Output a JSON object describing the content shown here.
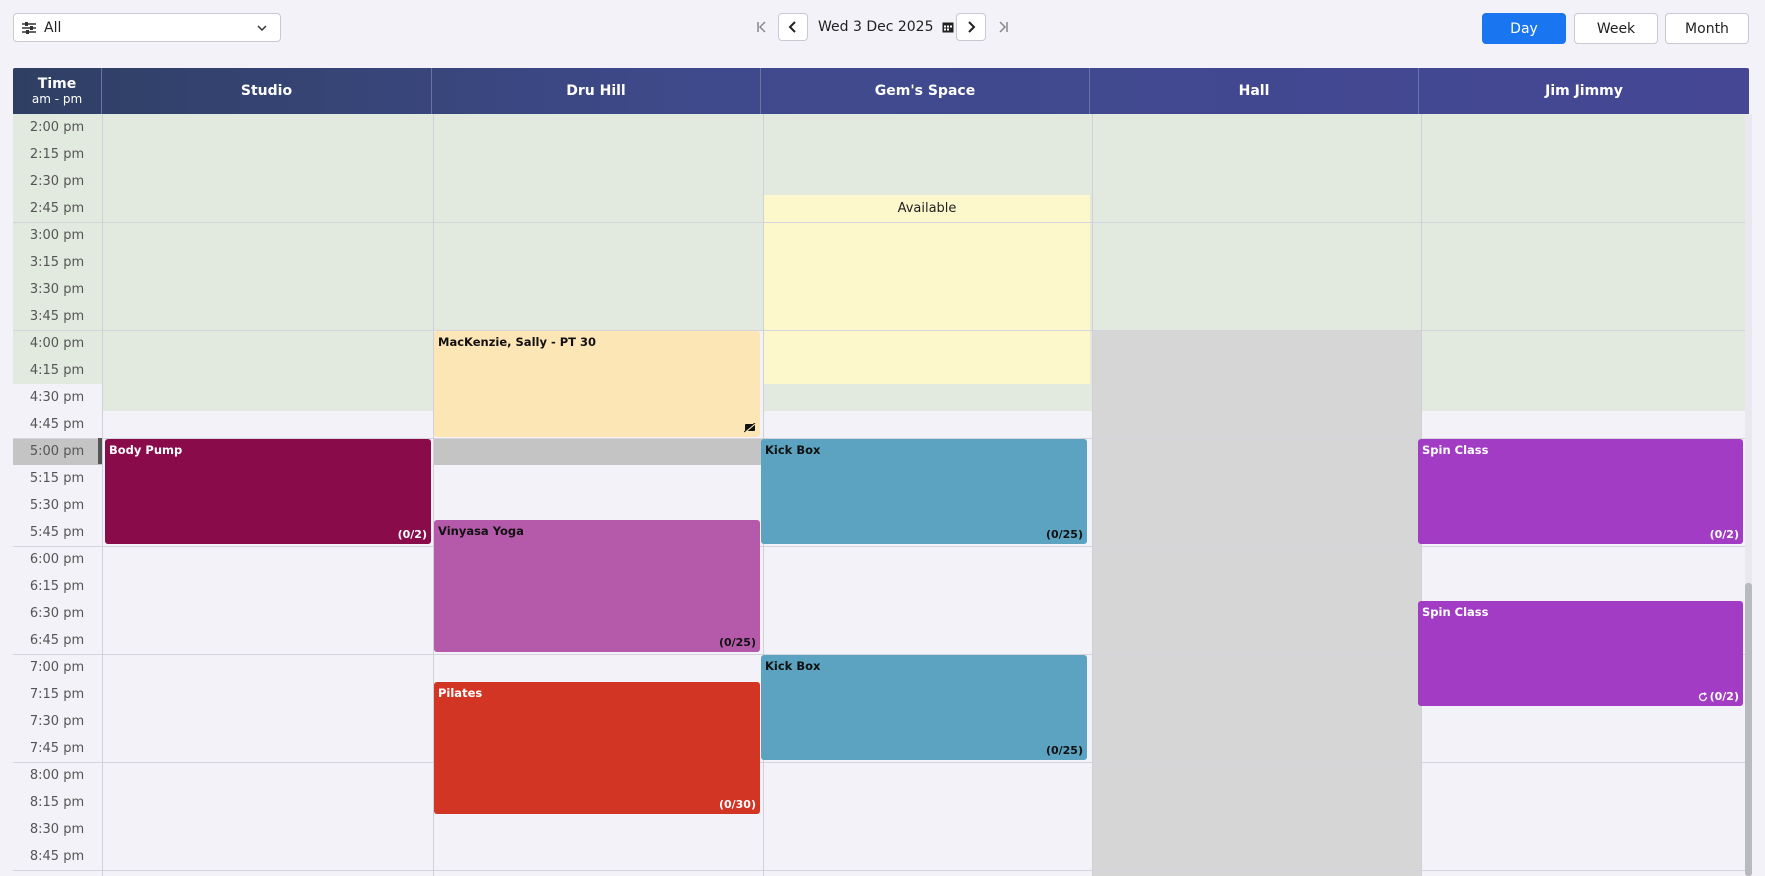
{
  "toolbar": {
    "filter_value": "All",
    "date_label": "Wed 3 Dec 2025",
    "views": [
      "Day",
      "Week",
      "Month"
    ],
    "active_view": "Day",
    "active_color": "#1976f0"
  },
  "header": {
    "time_title": "Time",
    "time_sub": "am - pm",
    "columns": [
      "Studio",
      "Dru Hill",
      "Gem's Space",
      "Hall",
      "Jim Jimmy"
    ]
  },
  "times": [
    "2:00 pm",
    "2:15 pm",
    "2:30 pm",
    "2:45 pm",
    "3:00 pm",
    "3:15 pm",
    "3:30 pm",
    "3:45 pm",
    "4:00 pm",
    "4:15 pm",
    "4:30 pm",
    "4:45 pm",
    "5:00 pm",
    "5:15 pm",
    "5:30 pm",
    "5:45 pm",
    "6:00 pm",
    "6:15 pm",
    "6:30 pm",
    "6:45 pm",
    "7:00 pm",
    "7:15 pm",
    "7:30 pm",
    "7:45 pm",
    "8:00 pm",
    "8:15 pm",
    "8:30 pm",
    "8:45 pm"
  ],
  "available_label": "Available",
  "events": {
    "body_pump": {
      "name": "Body Pump",
      "count": "(0/2)",
      "color": "#8a0b4a"
    },
    "mackenzie": {
      "name": "MacKenzie, Sally - PT 30",
      "color": "#fde6b6"
    },
    "vinyasa": {
      "name": "Vinyasa Yoga",
      "count": "(0/25)",
      "color": "#b55aaa"
    },
    "pilates": {
      "name": "Pilates",
      "count": "(0/30)",
      "color": "#d23523"
    },
    "kickbox1": {
      "name": "Kick Box",
      "count": "(0/25)",
      "color": "#5ba3c0"
    },
    "kickbox2": {
      "name": "Kick Box",
      "count": "(0/25)",
      "color": "#5ba3c0"
    },
    "spin1": {
      "name": "Spin Class",
      "count": "(0/2)",
      "color": "#a23cc4"
    },
    "spin2": {
      "name": "Spin Class",
      "count": "(0/2)",
      "color": "#a23cc4"
    }
  }
}
